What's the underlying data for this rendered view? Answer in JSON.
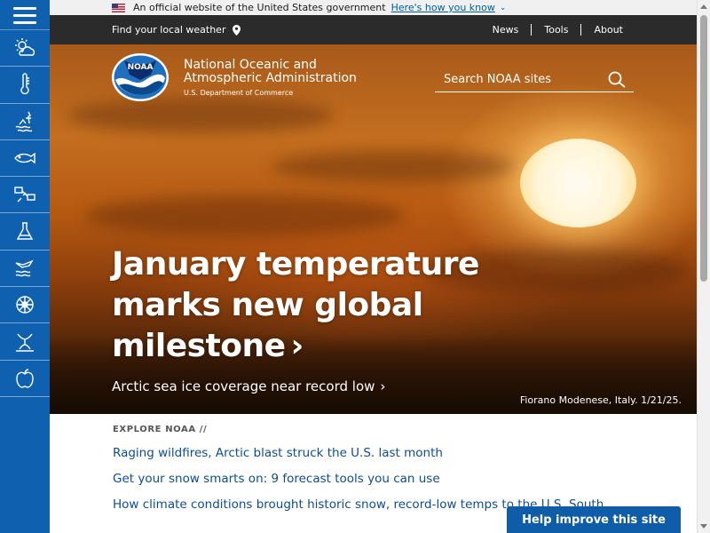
{
  "gov_banner": {
    "text": "An official website of the United States government",
    "link": "Here's how you know"
  },
  "topnav": {
    "local_weather": "Find your local weather",
    "links": [
      "News",
      "Tools",
      "About"
    ]
  },
  "org": {
    "logo_text": "NOAA",
    "name_line1": "National Oceanic and",
    "name_line2": "Atmospheric Administration",
    "dept": "U.S. Department of Commerce"
  },
  "search": {
    "placeholder": "Search NOAA sites"
  },
  "hero": {
    "headline_line1": "January temperature",
    "headline_line2": "marks new global",
    "headline_line3": "milestone",
    "subhead": "Arctic sea ice coverage near record low",
    "caption": "Fiorano Modenese, Italy. 1/21/25."
  },
  "explore": {
    "eyebrow": "EXPLORE NOAA //",
    "links": [
      "Raging wildfires, Arctic blast struck the U.S. last month",
      "Get your snow smarts on: 9 forecast tools you can use",
      "How climate conditions brought historic snow, record-low temps to the U.S. South"
    ]
  },
  "help_button": "Help improve this site",
  "sidebar": {
    "icons": [
      "weather-icon",
      "climate-icon",
      "ocean-coasts-icon",
      "fisheries-icon",
      "satellites-icon",
      "research-icon",
      "marine-aviation-icon",
      "charting-icon",
      "sanctuaries-icon",
      "education-icon"
    ]
  },
  "colors": {
    "sidebar": "#1060b0",
    "nav": "#2b2b2b",
    "link": "#0d4c9b",
    "button": "#0f5ca8"
  }
}
